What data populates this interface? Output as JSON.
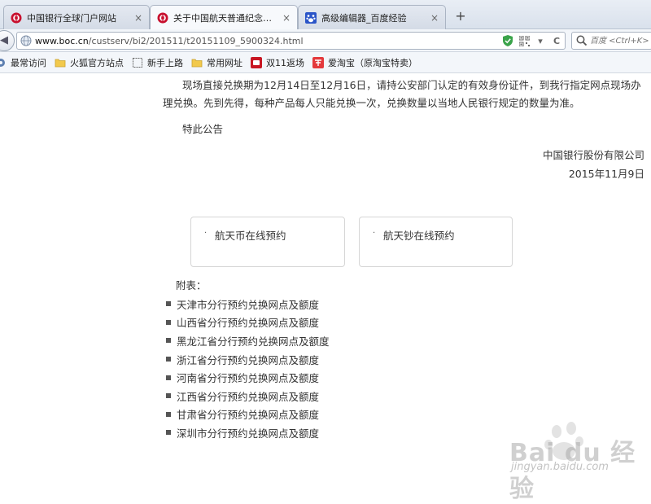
{
  "tabs": [
    {
      "label": "中国银行全球门户网站",
      "close": "×"
    },
    {
      "label": "关于中国航天普通纪念币...",
      "close": "×"
    },
    {
      "label": "高级编辑器_百度经验",
      "close": "×"
    }
  ],
  "new_tab": "+",
  "address": {
    "url_host": "www.boc.cn",
    "url_path": "/custserv/bi2/201511/t20151109_5900324.html",
    "reload": "C"
  },
  "search": {
    "placeholder": "百度 <Ctrl+K>"
  },
  "bookmarks": [
    {
      "label": "最常访问",
      "icon": "gear-icon"
    },
    {
      "label": "火狐官方站点",
      "icon": "folder-icon"
    },
    {
      "label": "新手上路",
      "icon": "page-icon"
    },
    {
      "label": "常用网址",
      "icon": "folder-icon"
    },
    {
      "label": "双11返场",
      "icon": "double11-icon"
    },
    {
      "label": "爱淘宝（原淘宝特卖）",
      "icon": "taobao-icon"
    }
  ],
  "content": {
    "paragraph": "现场直接兑换期为12月14日至12月16日，请持公安部门认定的有效身份证件，到我行指定网点现场办理兑换。先到先得，每种产品每人只能兑换一次，兑换数量以当地人民银行规定的数量为准。",
    "notice": "特此公告",
    "company": "中国银行股份有限公司",
    "date": "2015年11月9日",
    "link_coin": "航天币在线预约",
    "link_note": "航天钞在线预约",
    "attach_title": "附表：",
    "attachments": [
      "天津市分行预约兑换网点及额度",
      "山西省分行预约兑换网点及额度",
      "黑龙江省分行预约兑换网点及额度",
      "浙江省分行预约兑换网点及额度",
      "河南省分行预约兑换网点及额度",
      "江西省分行预约兑换网点及额度",
      "甘肃省分行预约兑换网点及额度",
      "深圳市分行预约兑换网点及额度"
    ]
  },
  "watermark": {
    "brand": "Bai du 经验",
    "sub": "jingyan.baidu.com"
  },
  "colors": {
    "boc_red": "#c8102e",
    "link_text": "#333333"
  }
}
